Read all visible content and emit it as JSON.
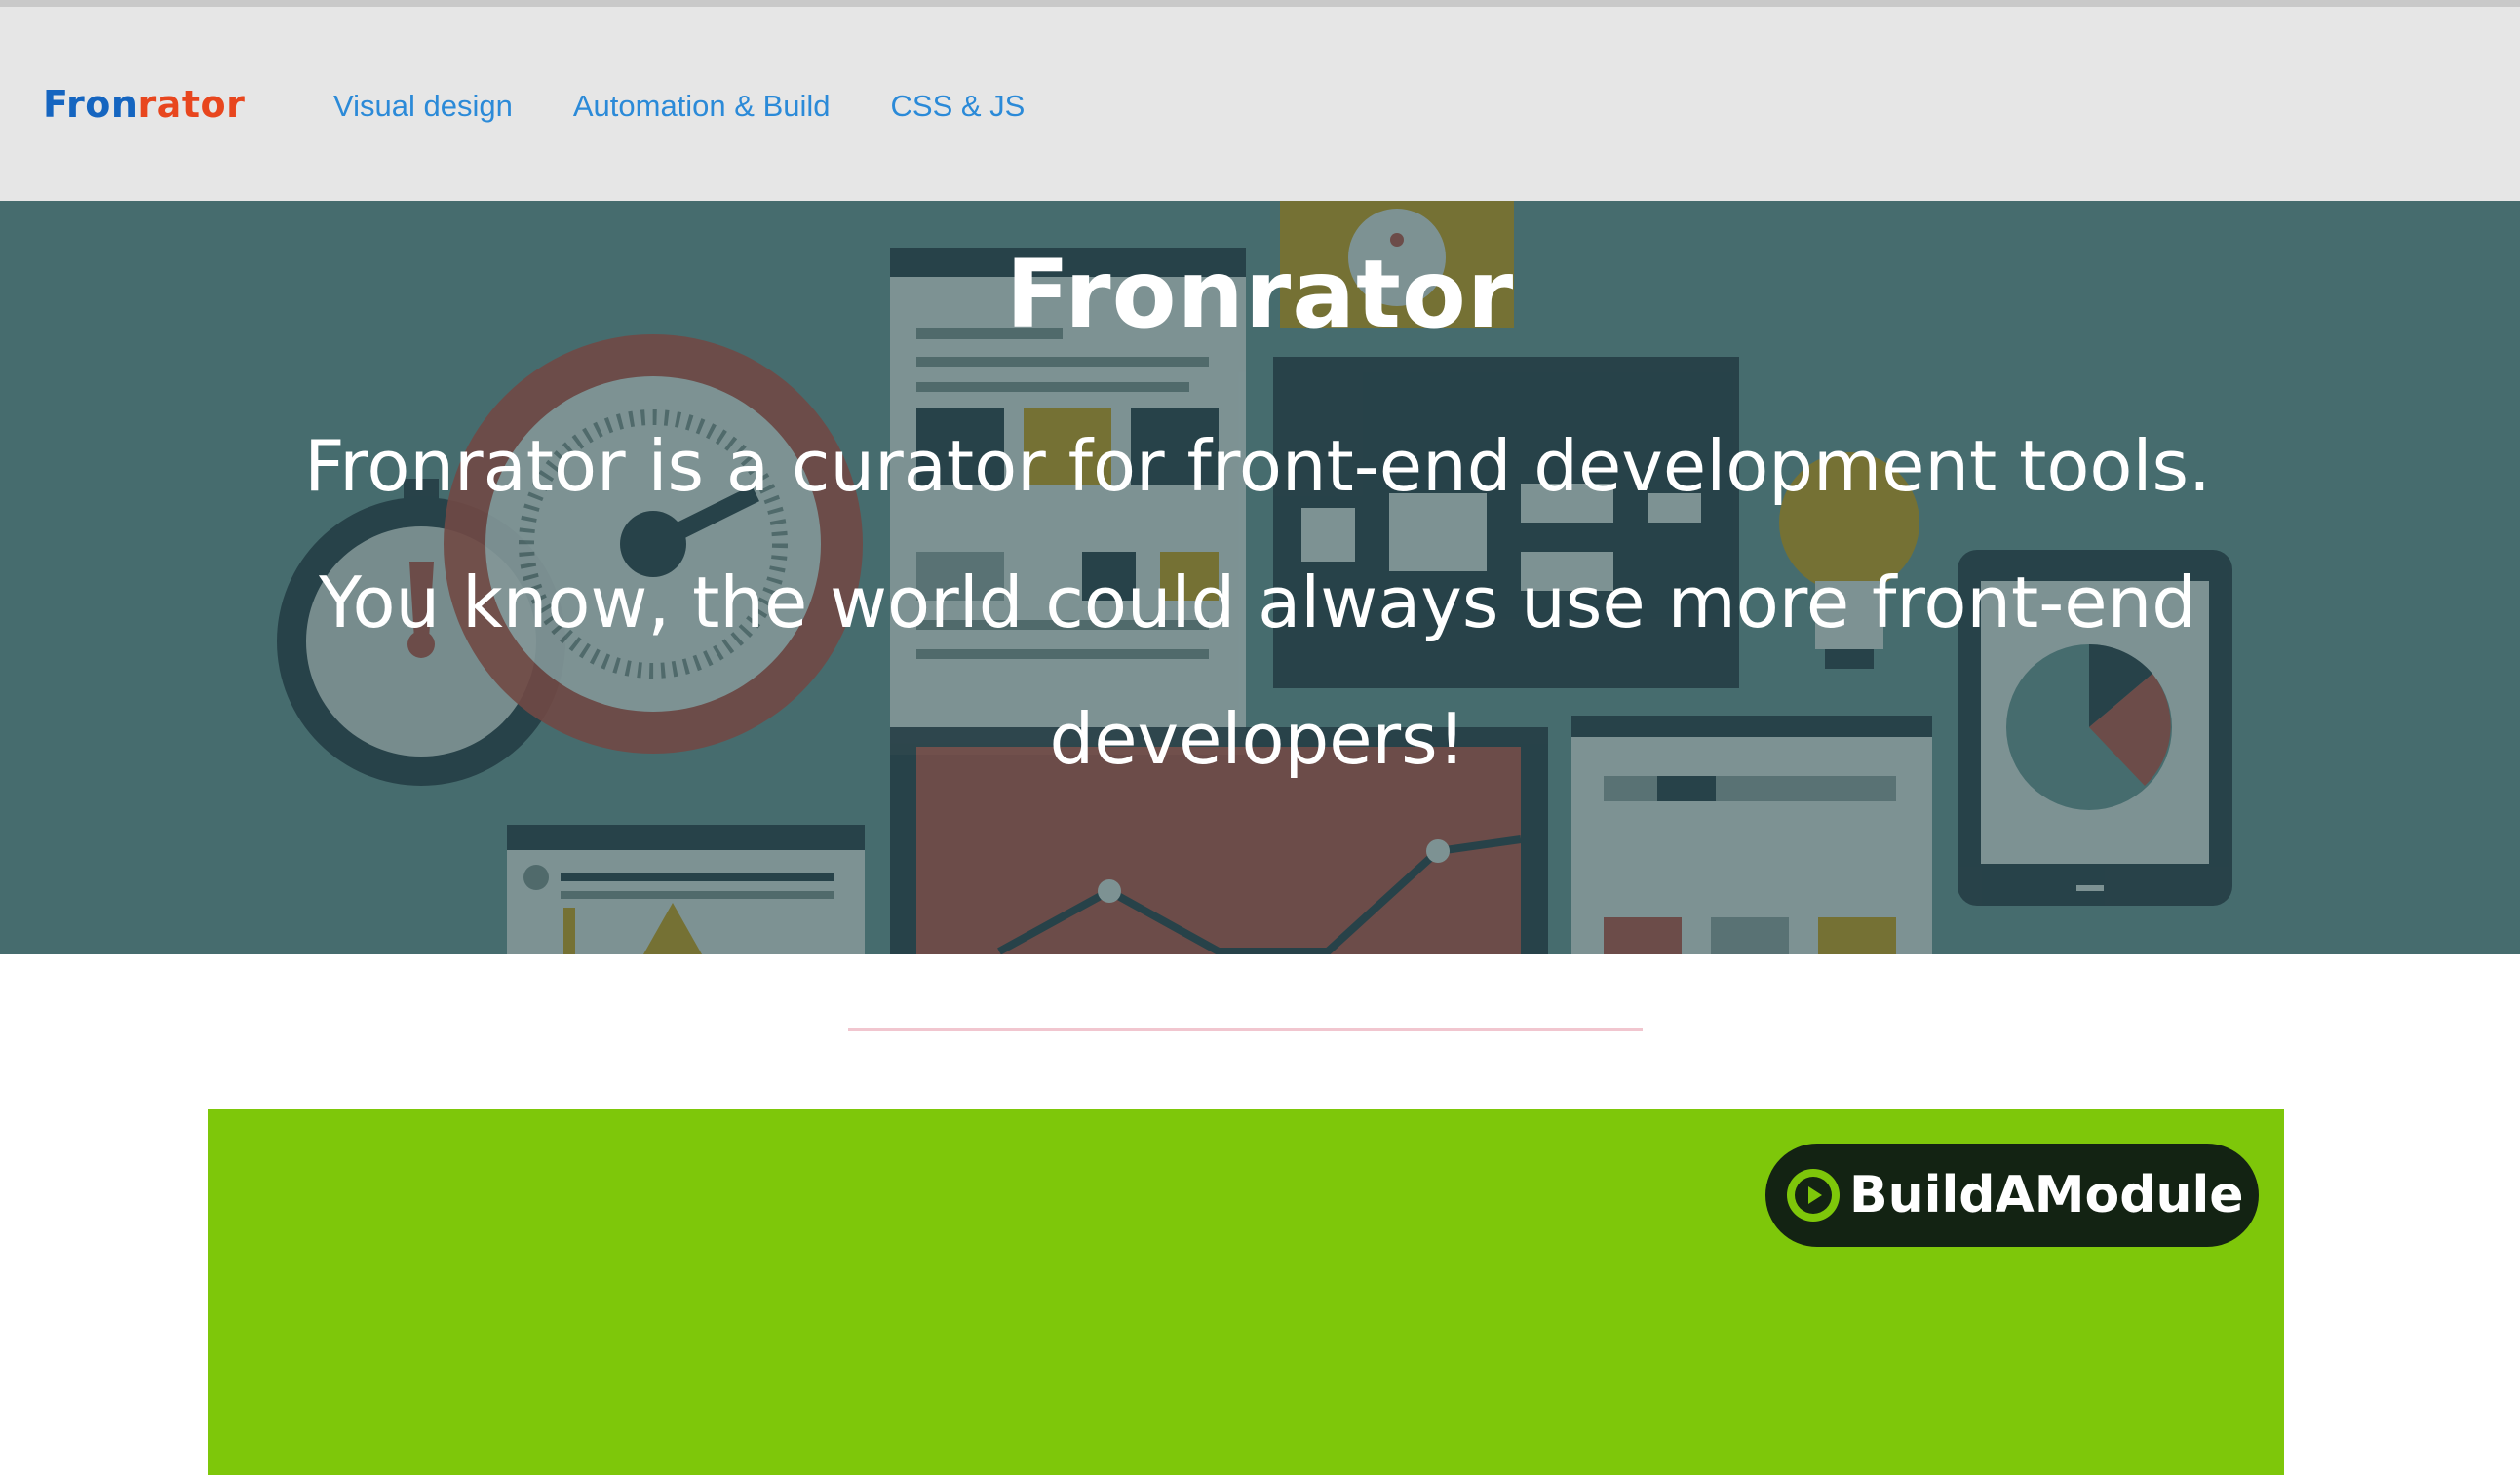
{
  "header": {
    "logo": {
      "part1": "Fron",
      "part2": "rator"
    },
    "nav": [
      {
        "label": "Visual design"
      },
      {
        "label": "Automation & Build"
      },
      {
        "label": "CSS & JS"
      }
    ]
  },
  "hero": {
    "title": "Fronrator",
    "text": "Fronrator is a curator for front-end development tools. You know, the world could always use more front-end developers!"
  },
  "ad": {
    "brand": "BuildAModule",
    "icon": "play-icon"
  },
  "colors": {
    "header_bg": "#e6e6e6",
    "logo_blue": "#1565c0",
    "logo_orange": "#e8461e",
    "nav_link": "#2b8ad8",
    "hero_bg": "#4a7172",
    "divider": "#f1c6cf",
    "ad_bg": "#7ec70a",
    "ad_badge": "#132313"
  }
}
